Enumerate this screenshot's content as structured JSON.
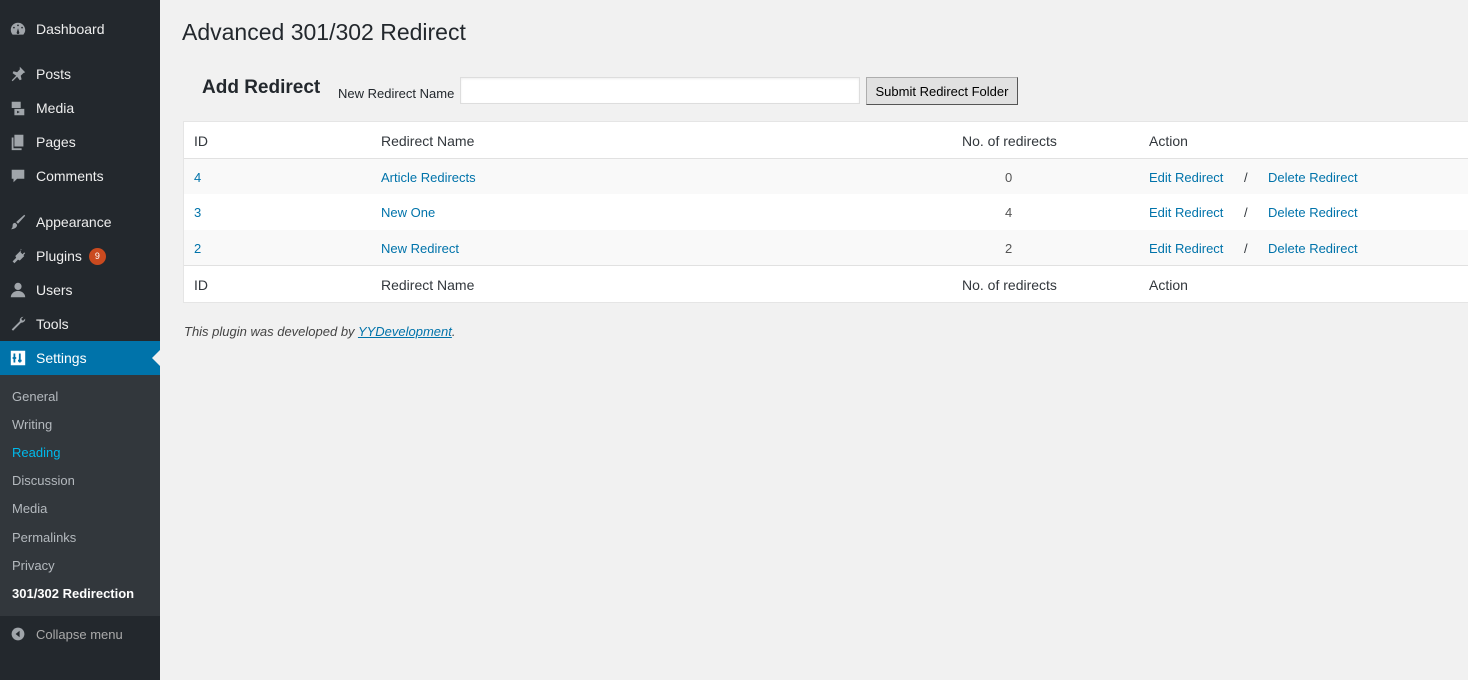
{
  "sidebar": {
    "items": [
      {
        "key": "dashboard",
        "label": "Dashboard",
        "icon": "dashboard-icon"
      },
      {
        "key": "posts",
        "label": "Posts",
        "icon": "pin-icon"
      },
      {
        "key": "media",
        "label": "Media",
        "icon": "media-icon"
      },
      {
        "key": "pages",
        "label": "Pages",
        "icon": "pages-icon"
      },
      {
        "key": "comments",
        "label": "Comments",
        "icon": "comment-icon"
      },
      {
        "key": "appearance",
        "label": "Appearance",
        "icon": "brush-icon"
      },
      {
        "key": "plugins",
        "label": "Plugins",
        "icon": "plug-icon",
        "badge": "9"
      },
      {
        "key": "users",
        "label": "Users",
        "icon": "user-icon"
      },
      {
        "key": "tools",
        "label": "Tools",
        "icon": "wrench-icon"
      },
      {
        "key": "settings",
        "label": "Settings",
        "icon": "sliders-icon",
        "current": true
      }
    ],
    "submenu": [
      "General",
      "Writing",
      "Reading",
      "Discussion",
      "Media",
      "Permalinks",
      "Privacy",
      "301/302 Redirection"
    ],
    "collapse_label": "Collapse menu"
  },
  "page": {
    "title": "Advanced 301/302 Redirect",
    "add_title": "Add Redirect",
    "field_label": "New Redirect Name",
    "field_value": "",
    "field_placeholder": "",
    "submit_label": "Submit Redirect Folder"
  },
  "table": {
    "headers": [
      "ID",
      "Redirect Name",
      "No. of redirects",
      "Action"
    ],
    "rows": [
      {
        "id": "4",
        "name": "Article Redirects",
        "count": "0",
        "edit": "Edit Redirect",
        "sep": "/",
        "delete": "Delete Redirect"
      },
      {
        "id": "3",
        "name": "New One",
        "count": "4",
        "edit": "Edit Redirect",
        "sep": "/",
        "delete": "Delete Redirect"
      },
      {
        "id": "2",
        "name": "New Redirect",
        "count": "2",
        "edit": "Edit Redirect",
        "sep": "/",
        "delete": "Delete Redirect"
      }
    ]
  },
  "footer": {
    "prefix": "This plugin was developed by ",
    "link": "YYDevelopment",
    "suffix": "."
  },
  "colors": {
    "sidebar_bg": "#23282d",
    "submenu_bg": "#32373c",
    "accent": "#0073aa",
    "highlight": "#00b9eb",
    "badge": "#ca4a1f"
  }
}
